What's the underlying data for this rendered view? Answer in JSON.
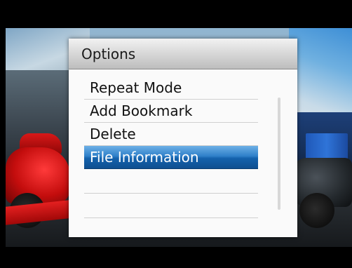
{
  "menu": {
    "title": "Options",
    "items": [
      {
        "label": "Repeat Mode",
        "selected": false
      },
      {
        "label": "Add Bookmark",
        "selected": false
      },
      {
        "label": "Delete",
        "selected": false
      },
      {
        "label": "File Information",
        "selected": true
      },
      {
        "label": "",
        "selected": false
      },
      {
        "label": "",
        "selected": false
      }
    ]
  },
  "colors": {
    "selection": "#1c6db8",
    "menu_background": "#fafafa",
    "header_background": "#cfcfcf"
  }
}
